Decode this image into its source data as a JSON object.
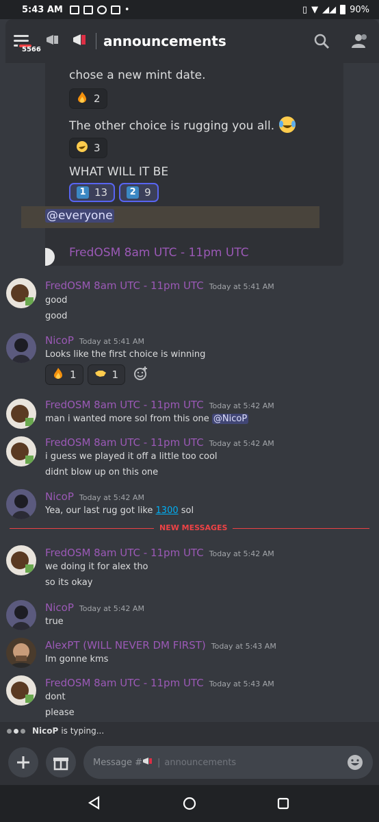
{
  "status_bar": {
    "time": "5:43 AM",
    "battery": "90%"
  },
  "header": {
    "menu_badge": "5566",
    "channel_name": "announcements"
  },
  "embed": {
    "line_top": "chose a new mint date.",
    "react_fire_count": "2",
    "other_choice": "The other choice is rugging you all.",
    "react_rofl_count": "3",
    "question": "WHAT WILL IT BE",
    "option1_key": "1",
    "option1_count": "13",
    "option2_key": "2",
    "option2_count": "9",
    "mention": "@everyone",
    "author": "FredOSM 8am UTC - 11pm UTC"
  },
  "messages": {
    "m1": {
      "author": "FredOSM 8am UTC - 11pm UTC",
      "time": "Today at 5:41 AM",
      "line1": "good",
      "line2": "good"
    },
    "m2": {
      "author": "NicoP",
      "time": "Today at 5:41 AM",
      "line1": "Looks like the first choice is winning",
      "react_fire": "1",
      "react_clap": "1"
    },
    "m3": {
      "author": "FredOSM 8am UTC - 11pm UTC",
      "time": "Today at 5:42 AM",
      "line1": "man i wanted more sol from this one",
      "mention": "@NicoP"
    },
    "m4": {
      "author": "FredOSM 8am UTC - 11pm UTC",
      "time": "Today at 5:42 AM",
      "line1": "i guess we played it off a little too cool",
      "line2": "didnt blow up on this one"
    },
    "m5": {
      "author": "NicoP",
      "time": "Today at 5:42 AM",
      "line1_pre": "Yea, our last rug got like",
      "line1_link": "1300",
      "line1_post": "sol"
    },
    "new_messages_label": "NEW MESSAGES",
    "m6": {
      "author": "FredOSM 8am UTC - 11pm UTC",
      "time": "Today at 5:42 AM",
      "line1": "we doing it for alex tho",
      "line2": "so its okay"
    },
    "m7": {
      "author": "NicoP",
      "time": "Today at 5:42 AM",
      "line1": "true"
    },
    "m8": {
      "author": "AlexPT (WILL NEVER DM FIRST)",
      "time": "Today at 5:43 AM",
      "line1": "Im gonne kms"
    },
    "m9": {
      "author": "FredOSM 8am UTC - 11pm UTC",
      "time": "Today at 5:43 AM",
      "line1": "dont",
      "line2": "please"
    }
  },
  "typing": {
    "user": "NicoP",
    "text": "is typing..."
  },
  "composer": {
    "placeholder_prefix": "Message #",
    "channel": "announcements"
  },
  "colors": {
    "background": "#36393f",
    "username": "#9b59b6",
    "accent": "#5865f2",
    "new_messages": "#ed4245",
    "link": "#00aff4"
  },
  "icons": [
    "hamburger-icon",
    "megaphone-icon",
    "search-icon",
    "members-icon",
    "plus-icon",
    "gift-icon",
    "emoji-icon",
    "back-icon",
    "home-icon",
    "recents-icon"
  ]
}
